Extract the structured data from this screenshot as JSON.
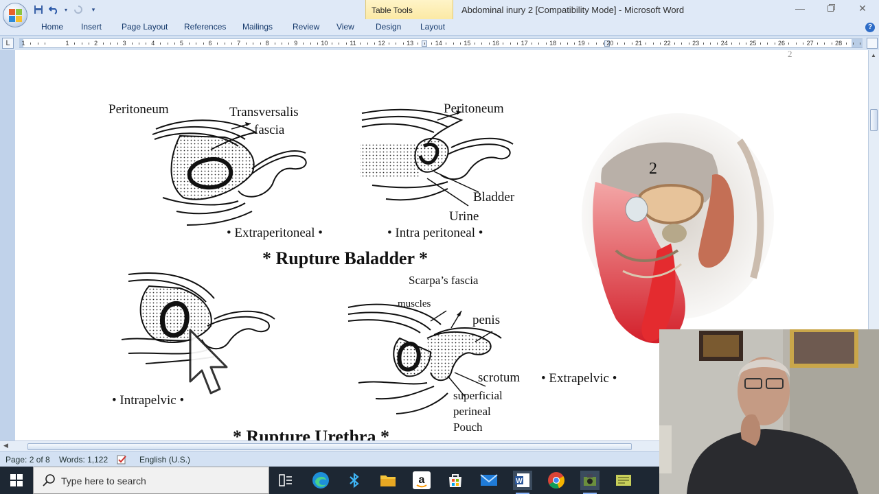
{
  "window": {
    "title": "Abdominal inury  2 [Compatibility Mode] - Microsoft Word",
    "contextual_tab_group": "Table Tools"
  },
  "ribbon": {
    "tabs": [
      "Home",
      "Insert",
      "Page Layout",
      "References",
      "Mailings",
      "Review",
      "View",
      "Design",
      "Layout"
    ]
  },
  "ruler": {
    "numbers": [
      "1",
      "1",
      "2",
      "3",
      "4",
      "5",
      "6",
      "7",
      "8",
      "9",
      "10",
      "11",
      "12",
      "13",
      "14",
      "15",
      "16",
      "17",
      "18",
      "19",
      "20",
      "21",
      "22",
      "23",
      "24",
      "25",
      "26",
      "27",
      "28"
    ]
  },
  "document": {
    "page_corner_number": "2",
    "figure_number": "2",
    "labels": {
      "peritoneum_1": "Peritoneum",
      "transversalis": "Transversalis",
      "fascia": "fascia",
      "peritoneum_2": "Peritoneum",
      "bladder": "Bladder",
      "urine": "Urine",
      "extraperitoneal": "• Extraperitoneal •",
      "intraperitoneal": "• Intra peritoneal •",
      "scarpas_fascia": "Scarpa’s fascia",
      "muscles": "muscles",
      "penis": "penis",
      "scrotum": "scrotum",
      "extrapelvic": "• Extrapelvic •",
      "superficial": "superficial",
      "perineal": "perineal",
      "pouch": "Pouch",
      "intrapelvic": "• Intrapelvic •"
    },
    "headings": {
      "rupture_bladder": "* Rupture Baladder *",
      "rupture_urethra": "* Rupture Urethra *"
    }
  },
  "statusbar": {
    "page": "Page: 2 of 8",
    "words": "Words: 1,122",
    "language": "English (U.S.)"
  },
  "taskbar": {
    "search_placeholder": "Type here to search",
    "apps": [
      "task-view-icon",
      "edge-icon",
      "bluetooth-app-icon",
      "file-explorer-icon",
      "amazon-icon",
      "store-icon",
      "mail-icon",
      "word-icon",
      "chrome-icon",
      "camera-app-icon",
      "notes-app-icon"
    ]
  },
  "colors": {
    "ribbon_bg": "#dfe9f7",
    "tab_text": "#15396b",
    "contextual_tab": "#fbe9a4",
    "taskbar": "#1d2733"
  }
}
